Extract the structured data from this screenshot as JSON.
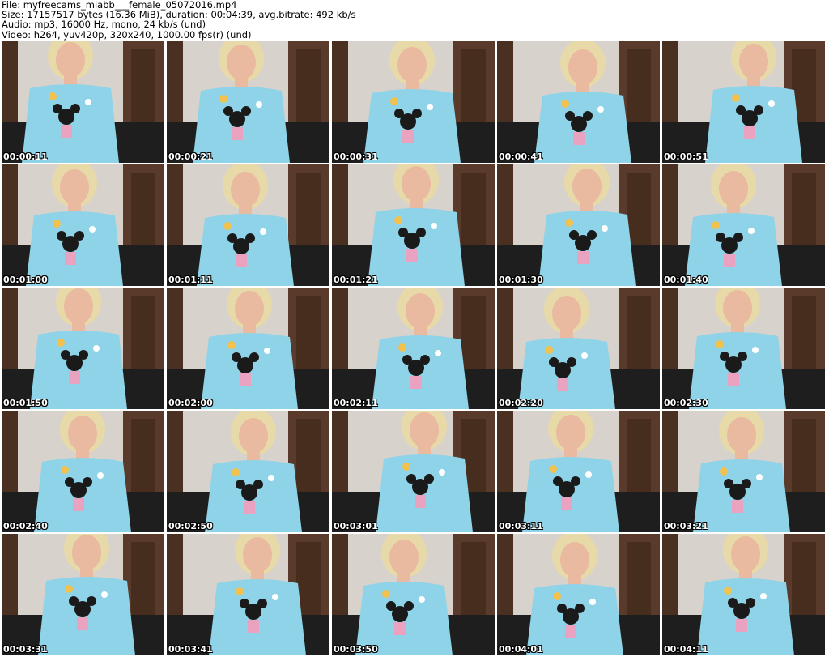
{
  "header": {
    "file_line": "File: myfreecams_miabb___female_05072016.mp4",
    "size_line": "Size: 17157517 bytes (16.36 MiB), duration: 00:04:39, avg.bitrate: 492 kb/s",
    "audio_line": "Audio: mp3, 16000 Hz, mono, 24 kb/s (und)",
    "video_line": "Video: h264, yuv420p, 320x240, 1000.00 fps(r) (und)"
  },
  "frames": [
    {
      "timestamp": "00:00:11"
    },
    {
      "timestamp": "00:00:21"
    },
    {
      "timestamp": "00:00:31"
    },
    {
      "timestamp": "00:00:41"
    },
    {
      "timestamp": "00:00:51"
    },
    {
      "timestamp": "00:01:00"
    },
    {
      "timestamp": "00:01:11"
    },
    {
      "timestamp": "00:01:21"
    },
    {
      "timestamp": "00:01:30"
    },
    {
      "timestamp": "00:01:40"
    },
    {
      "timestamp": "00:01:50"
    },
    {
      "timestamp": "00:02:00"
    },
    {
      "timestamp": "00:02:11"
    },
    {
      "timestamp": "00:02:20"
    },
    {
      "timestamp": "00:02:30"
    },
    {
      "timestamp": "00:02:40"
    },
    {
      "timestamp": "00:02:50"
    },
    {
      "timestamp": "00:03:01"
    },
    {
      "timestamp": "00:03:11"
    },
    {
      "timestamp": "00:03:21"
    },
    {
      "timestamp": "00:03:31"
    },
    {
      "timestamp": "00:03:41"
    },
    {
      "timestamp": "00:03:50"
    },
    {
      "timestamp": "00:04:01"
    },
    {
      "timestamp": "00:04:11"
    }
  ],
  "colors": {
    "background": "#ffffff",
    "shirt": "#8fd3e8",
    "wall": "#d8d2cc",
    "door": "#5a3a2a",
    "chair": "#1e1e1e",
    "hair": "#e8d9a8",
    "skin": "#e9b9a0"
  }
}
